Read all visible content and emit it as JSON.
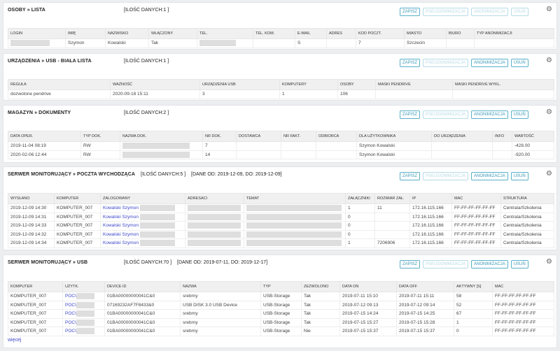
{
  "panel1": {
    "title": "OSOBY » LISTA",
    "count": "[ILOŚĆ DANYCH:1 ]",
    "buttons": [
      "ZAPISZ",
      "PSEUDONIMIZACJA",
      "ANONIMIZACJA",
      "USUŃ"
    ],
    "headers": [
      "LOGIN",
      "IMIĘ",
      "NAZWISKO",
      "WŁĄCZONY",
      "TEL.",
      "TEL. KOM.",
      "E-MAIL",
      "ADRES",
      "KOD POCZT.",
      "MIASTO",
      "BIURO",
      "TYP ANONIMIZACJI"
    ],
    "row": [
      "",
      "Szymon",
      "Kowalski",
      "Tak",
      "",
      "",
      "S",
      "",
      "7",
      "Szczecin",
      "",
      ""
    ]
  },
  "panel2": {
    "title": "URZĄDZENIA » USB - BIAŁA LISTA",
    "count": "[ILOŚĆ DANYCH:1 ]",
    "buttons": [
      "ZAPISZ",
      "PSEUDONIMIZACJA",
      "ANONIMIZACJA",
      "USUŃ"
    ],
    "headers": [
      "REGUŁA",
      "WAŻNOŚĆ",
      "URZĄDZENIA USB",
      "KOMPUTERY",
      "OSOBY",
      "MASKI PENDRIVE",
      "MASKI PENDRIVE WYKL."
    ],
    "row": [
      "dozwolone pendrive",
      "2020-09-18 15:11",
      "3",
      "1",
      "106",
      "",
      ""
    ]
  },
  "panel3": {
    "title": "MAGAZYN » DOKUMENTY",
    "count": "[ILOŚĆ DANYCH:2 ]",
    "buttons": [
      "ZAPISZ",
      "PSEUDONIMIZACJA",
      "ANONIMIZACJA",
      "USUŃ"
    ],
    "headers": [
      "DATA OPER.",
      "TYP DOK.",
      "NAZWA DOK.",
      "NR DOK.",
      "DOSTAWCA",
      "NR FAKT.",
      "ODBIORCA",
      "DLA UŻYTKOWNIKA",
      "DO URZĄDZENIA",
      "INFO",
      "WARTOŚĆ"
    ],
    "rows": [
      [
        "2019-11-04 08:19",
        "RW",
        "",
        "7",
        "",
        "",
        "",
        "Szymon Kowalski",
        "",
        "",
        "-428.00"
      ],
      [
        "2020-02-06 12:44",
        "RW",
        "",
        "14",
        "",
        "",
        "",
        "Szymon Kowalski",
        "",
        "",
        "-920.00"
      ]
    ]
  },
  "panel4": {
    "title": "SERWER MONITORUJĄCY » POCZTA WYCHODZĄCA",
    "count": "[ILOŚĆ DANYCH:5 ]",
    "range": "[DANE OD: 2019-12-09, DO: 2019-12-09]",
    "buttons": [
      "ZAPISZ",
      "PSEUDONIMIZACJA",
      "ANONIMIZACJA",
      "USUŃ"
    ],
    "headers": [
      "WYSŁANO",
      "KOMPUTER",
      "ZALOGOWANY",
      "ADRESACI",
      "TEMAT",
      "ZAŁĄCZNIKI",
      "ROZMIAR ZAŁ.",
      "IP",
      "MAC",
      "STRUKTURA"
    ],
    "rows": [
      [
        "2019-12-09 14:30",
        "KOMPUTER_007",
        "Kowalski Szymon",
        "",
        "",
        "1",
        "11",
        "172.16.115.166",
        "FF-FF-FF-FF-FF-FF",
        "Centrala/Szkolenia"
      ],
      [
        "2019-12-09 14:31",
        "KOMPUTER_007",
        "Kowalski Szymon",
        "",
        "",
        "0",
        "",
        "172.16.115.166",
        "FF-FF-FF-FF-FF-FF",
        "Centrala/Szkolenia"
      ],
      [
        "2019-12-09 14:33",
        "KOMPUTER_007",
        "Kowalski Szymon",
        "",
        "",
        "0",
        "",
        "172.16.115.166",
        "FF-FF-FF-FF-FF-FF",
        "Centrala/Szkolenia"
      ],
      [
        "2019-12-09 14:32",
        "KOMPUTER_007",
        "Kowalski Szymon",
        "",
        "",
        "0",
        "",
        "172.16.115.166",
        "FF-FF-FF-FF-FF-FF",
        "Centrala/Szkolenia"
      ],
      [
        "2019-12-09 14:34",
        "KOMPUTER_007",
        "Kowalski Szymon",
        "",
        "",
        "1",
        "7206906",
        "172.16.115.166",
        "FF-FF-FF-FF-FF-FF",
        "Centrala/Szkolenia"
      ]
    ]
  },
  "panel5": {
    "title": "SERWER MONITORUJĄCY » USB",
    "count": "[ILOŚĆ DANYCH:70 ]",
    "range": "[DANE OD: 2019-07-11, DO: 2019-12-17]",
    "buttons": [
      "ZAPISZ",
      "PSEUDONIMIZACJA",
      "ANONIMIZACJA",
      "USUŃ"
    ],
    "headers": [
      "KOMPUTER",
      "UŻYTK.",
      "DEVICE ID",
      "NAZWA",
      "TYP",
      "ZEZWOLONO",
      "DATA ON",
      "DATA OFF",
      "AKTYWNY [S]",
      "MAC"
    ],
    "rows": [
      [
        "KOMPUTER_007",
        "POC\\",
        "01BA00000000041C&0",
        "srebrny",
        "USB-Storage",
        "Tak",
        "2019-07-11 15:10",
        "2019-07-11 15:11",
        "58",
        "FF-FF-FF-FF-FF-FF"
      ],
      [
        "KOMPUTER_007",
        "POC\\",
        "07169232AF7F8433&0",
        "USB DISK 3.0 USB Device",
        "USB-Storage",
        "Tak",
        "2019-07-12 09:13",
        "2019-07-12 09:14",
        "52",
        "FF-FF-FF-FF-FF-FF"
      ],
      [
        "KOMPUTER_007",
        "POC\\",
        "01BA00000000041C&0",
        "srebrny",
        "USB-Storage",
        "Tak",
        "2019-07-15 14:24",
        "2019-07-15 14:25",
        "67",
        "FF-FF-FF-FF-FF-FF"
      ],
      [
        "KOMPUTER_007",
        "POC\\",
        "01BA00000000041C&0",
        "srebrny",
        "USB-Storage",
        "Tak",
        "2019-07-15 15:27",
        "2019-07-15 15:28",
        "1",
        "FF-FF-FF-FF-FF-FF"
      ],
      [
        "KOMPUTER_007",
        "POC\\",
        "01BA00000000041C&0",
        "srebrny",
        "USB-Storage",
        "Nie",
        "2019-07-15 15:37",
        "2019-07-15 15:37",
        "0",
        "FF-FF-FF-FF-FF-FF"
      ]
    ],
    "more": "więcej"
  },
  "colors": {
    "link": "#3b46c8",
    "button": "#3b9ab8",
    "button_disabled": "#b8dbe6",
    "background": "#eceef0"
  },
  "icons": {
    "settings": "gear-icon"
  }
}
